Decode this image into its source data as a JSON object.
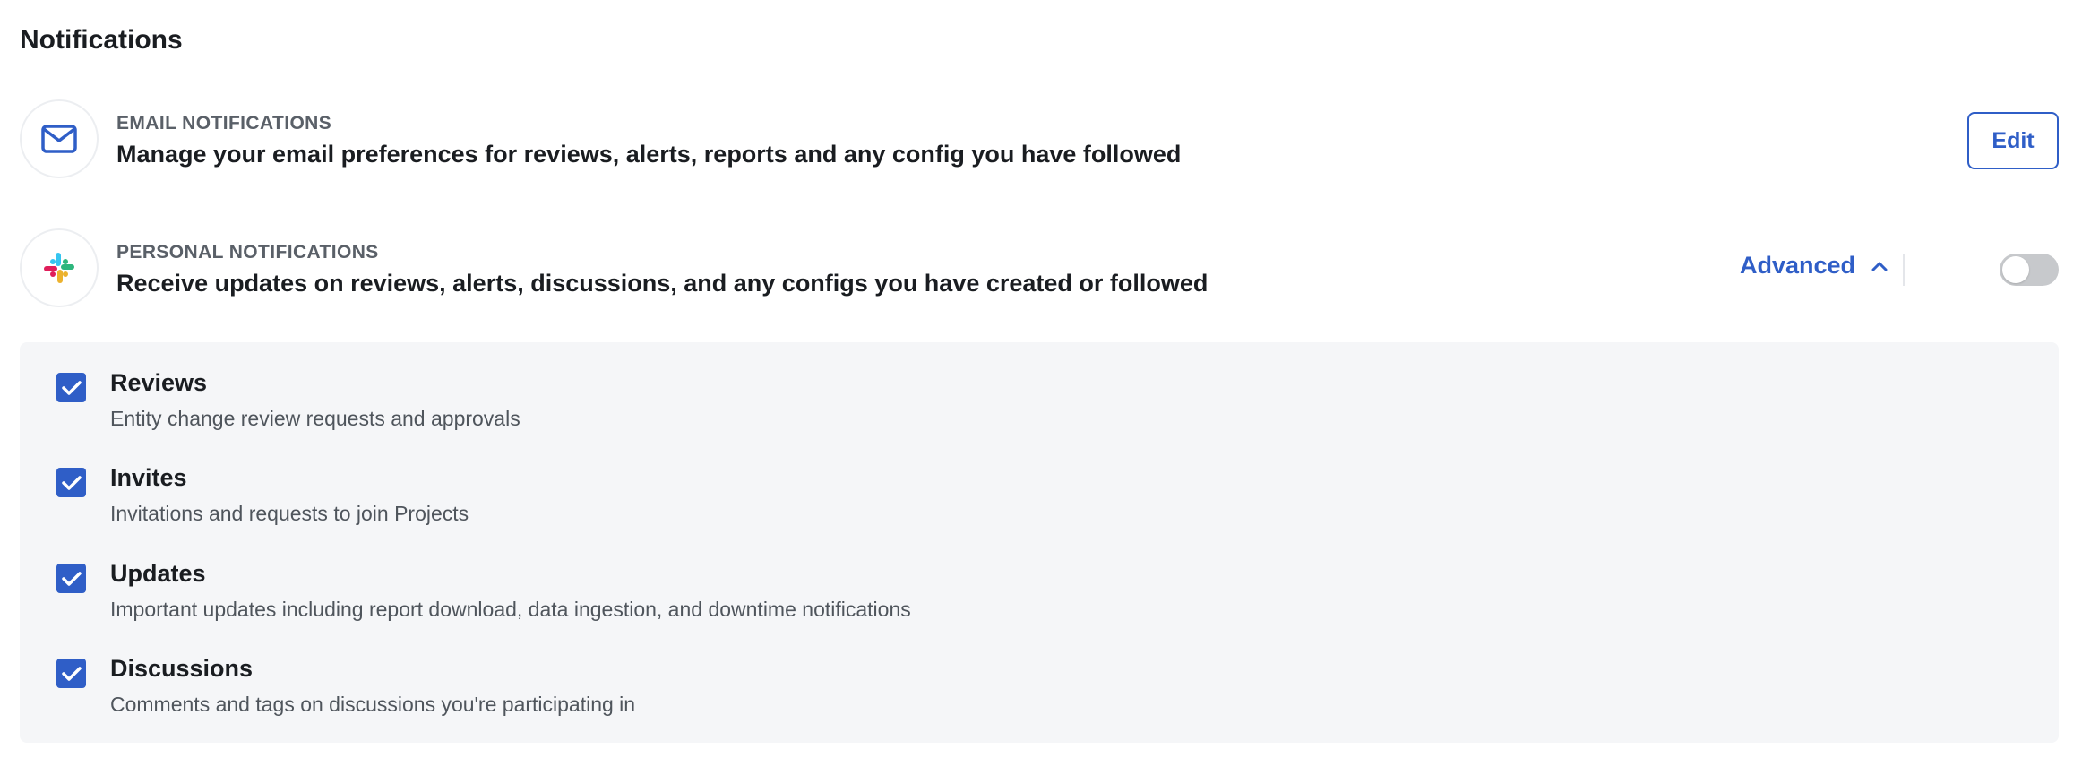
{
  "page": {
    "title": "Notifications"
  },
  "email": {
    "icon": "mail-icon",
    "label": "EMAIL NOTIFICATIONS",
    "description": "Manage your email preferences for reviews, alerts, reports and any config you have followed",
    "edit_label": "Edit"
  },
  "personal": {
    "icon": "slack-icon",
    "label": "PERSONAL NOTIFICATIONS",
    "description": "Receive updates on reviews, alerts, discussions, and any configs you have created or followed",
    "advanced_label": "Advanced",
    "advanced_expanded": true,
    "toggle_on": false
  },
  "options": [
    {
      "title": "Reviews",
      "description": "Entity change review requests and approvals",
      "checked": true
    },
    {
      "title": "Invites",
      "description": "Invitations and requests to join Projects",
      "checked": true
    },
    {
      "title": "Updates",
      "description": "Important updates including report download, data ingestion, and downtime notifications",
      "checked": true
    },
    {
      "title": "Discussions",
      "description": "Comments and tags on discussions you're participating in",
      "checked": true
    }
  ],
  "colors": {
    "accent": "#2f5ec7",
    "panel_bg": "#f5f6f8",
    "toggle_off": "#c7c9cc"
  }
}
